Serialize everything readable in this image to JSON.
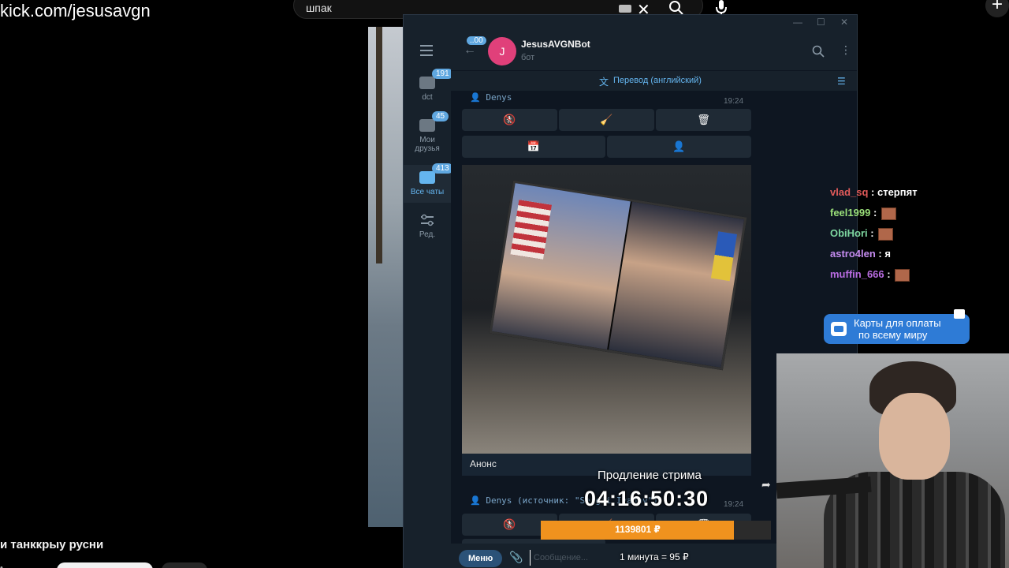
{
  "browser": {
    "url": "kick.com/jesusavgn",
    "search_query": "шпак"
  },
  "video": {
    "title": "и танккрыу русни"
  },
  "telegram": {
    "folders": [
      {
        "label": "dct",
        "badge": "191"
      },
      {
        "label": "Мои друзья",
        "badge": "45"
      },
      {
        "label": "Все чаты",
        "badge": "413"
      },
      {
        "label": "Ред.",
        "badge": ""
      }
    ],
    "back_badge": "..00",
    "chat": {
      "avatar_letter": "J",
      "name": "JesusAVGNBot",
      "subtitle": "бот"
    },
    "translate_label": "Перевод (английский)",
    "messages": [
      {
        "sender": "👤 Denys",
        "time": "19:24"
      },
      {
        "sender": "👤 Denys (источник: \"Sergii Ivanov\")",
        "time": "19:24"
      }
    ],
    "keyboard_row1": [
      "🚷",
      "🧹",
      "🗑"
    ],
    "keyboard_row2": [
      "📅",
      "👤"
    ],
    "photo_caption": "Анонс",
    "menu_button": "Меню",
    "input_placeholder": "Сообщение..."
  },
  "stream_chat": [
    {
      "user": "vlad_sq",
      "color": "#e05a5a",
      "text": "стерпят",
      "emote": false
    },
    {
      "user": "feel1999",
      "color": "#9be07a",
      "text": "",
      "emote": true
    },
    {
      "user": "ObiHori",
      "color": "#7ed6a0",
      "text": "",
      "emote": true
    },
    {
      "user": "astro4len",
      "color": "#c58cf0",
      "text": "я",
      "emote": false
    },
    {
      "user": "muffin_666",
      "color": "#b86be0",
      "text": "",
      "emote": true
    }
  ],
  "ad": {
    "line1": "Карты для оплаты",
    "line2": "по всему миру"
  },
  "stream_overlay": {
    "subathon_title": "Продление стрима",
    "timer": "04:16:50:30",
    "progress_value": "1139801 ₽",
    "progress_fraction": 0.84,
    "rate": "1 минута = 95 ₽",
    "bar_color": "#f0921e"
  }
}
